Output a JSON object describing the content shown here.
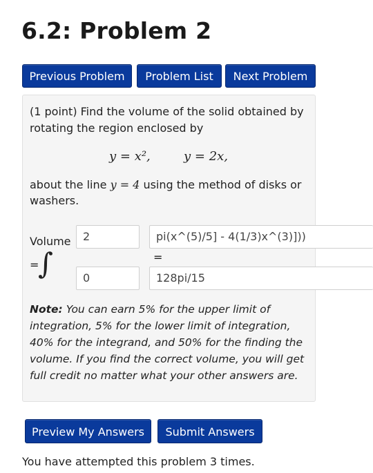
{
  "page": {
    "title": "6.2: Problem 2"
  },
  "nav": {
    "previous": "Previous Problem",
    "list": "Problem List",
    "next": "Next Problem"
  },
  "problem": {
    "intro_line1": "(1 point) Find the volume of the solid obtained by",
    "intro_line2": "rotating the region enclosed by",
    "eq1": "y = x²,",
    "eq2": "y = 2x,",
    "about_prefix": "about the line",
    "about_eq": "y = 4",
    "about_suffix": "using the method of disks or",
    "about_line2": "washers."
  },
  "answer": {
    "volume_label": "Volume",
    "equals_label": "=",
    "integral_symbol": "∫",
    "upper_limit": "2",
    "integrand": "pi(x^(5)/5] - 4(1/3)x^(3)]))",
    "lower_limit": "0",
    "equals_between": "=",
    "volume_value": "128pi/15"
  },
  "note": {
    "label": "Note:",
    "text": "You can earn 5% for the upper limit of integration, 5% for the lower limit of integration, 40% for the integrand, and 50% for the finding the volume. If you find the correct volume, you will get full credit no matter what your other answers are."
  },
  "actions": {
    "preview": "Preview My Answers",
    "submit": "Submit Answers"
  },
  "status": {
    "attempts": "You have attempted this problem 3 times."
  },
  "colors": {
    "button_bg": "#0a3a9c",
    "panel_bg": "#f5f5f5"
  }
}
